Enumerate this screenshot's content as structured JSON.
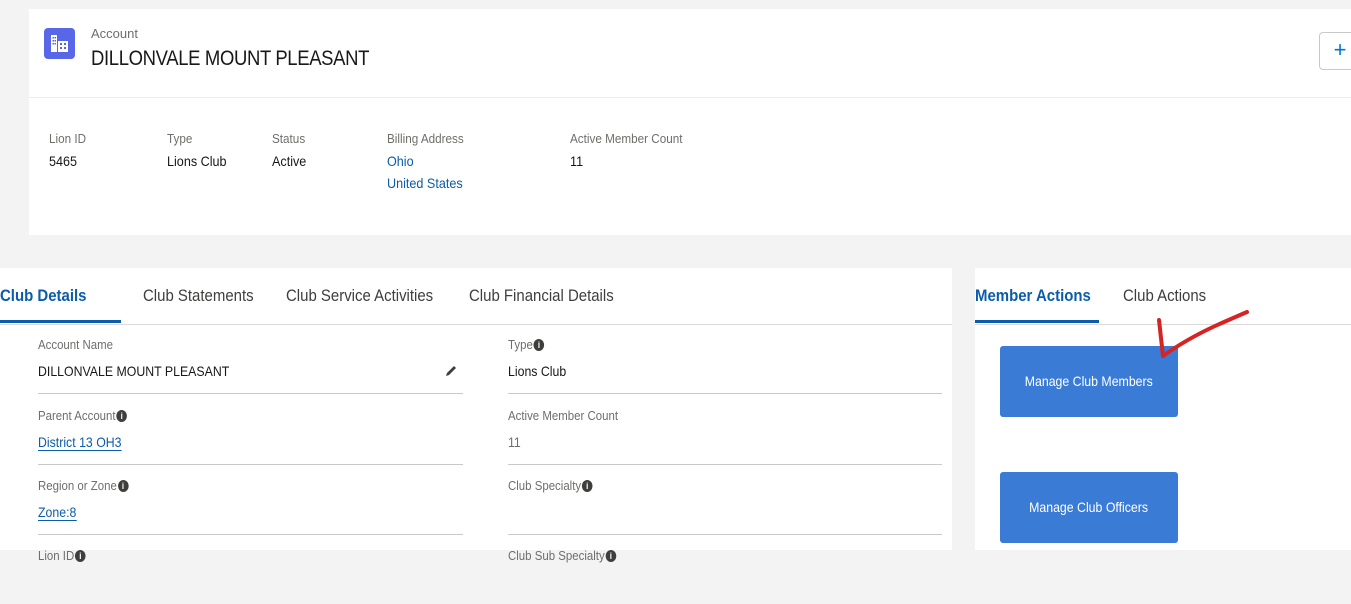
{
  "header": {
    "object_label": "Account",
    "record_name": "DILLONVALE MOUNT PLEASANT",
    "plus_label": "+"
  },
  "highlights": [
    {
      "label": "Lion ID",
      "value": "5465"
    },
    {
      "label": "Type",
      "value": "Lions Club"
    },
    {
      "label": "Status",
      "value": "Active"
    },
    {
      "label": "Billing Address",
      "line1": "Ohio",
      "line2": "United States"
    },
    {
      "label": "Active Member Count",
      "value": "11"
    }
  ],
  "tabs": [
    "Club Details",
    "Club Statements",
    "Club Service Activities",
    "Club Financial Details"
  ],
  "details": {
    "account_name": {
      "label": "Account Name",
      "value": "DILLONVALE MOUNT PLEASANT"
    },
    "type": {
      "label": "Type",
      "value": "Lions Club"
    },
    "parent_account": {
      "label": "Parent Account",
      "value": "District 13 OH3"
    },
    "active_member_count": {
      "label": "Active Member Count",
      "value": "11"
    },
    "region_or_zone": {
      "label": "Region or Zone",
      "value": "Zone:8"
    },
    "club_specialty": {
      "label": "Club Specialty",
      "value": ""
    },
    "lion_id": {
      "label": "Lion ID"
    },
    "club_sub_specialty": {
      "label": "Club Sub Specialty"
    }
  },
  "info_glyph": "i",
  "right_tabs": [
    "Member Actions",
    "Club Actions"
  ],
  "actions": {
    "manage_members": "Manage Club Members",
    "manage_officers": "Manage Club Officers"
  },
  "colors": {
    "link": "#0b5cab",
    "button": "#3a7bd5",
    "annotation": "#d62323",
    "icon": "#5867e8"
  },
  "icons": {
    "account": "account-building-icon",
    "edit": "pencil-icon",
    "info": "info-icon"
  }
}
